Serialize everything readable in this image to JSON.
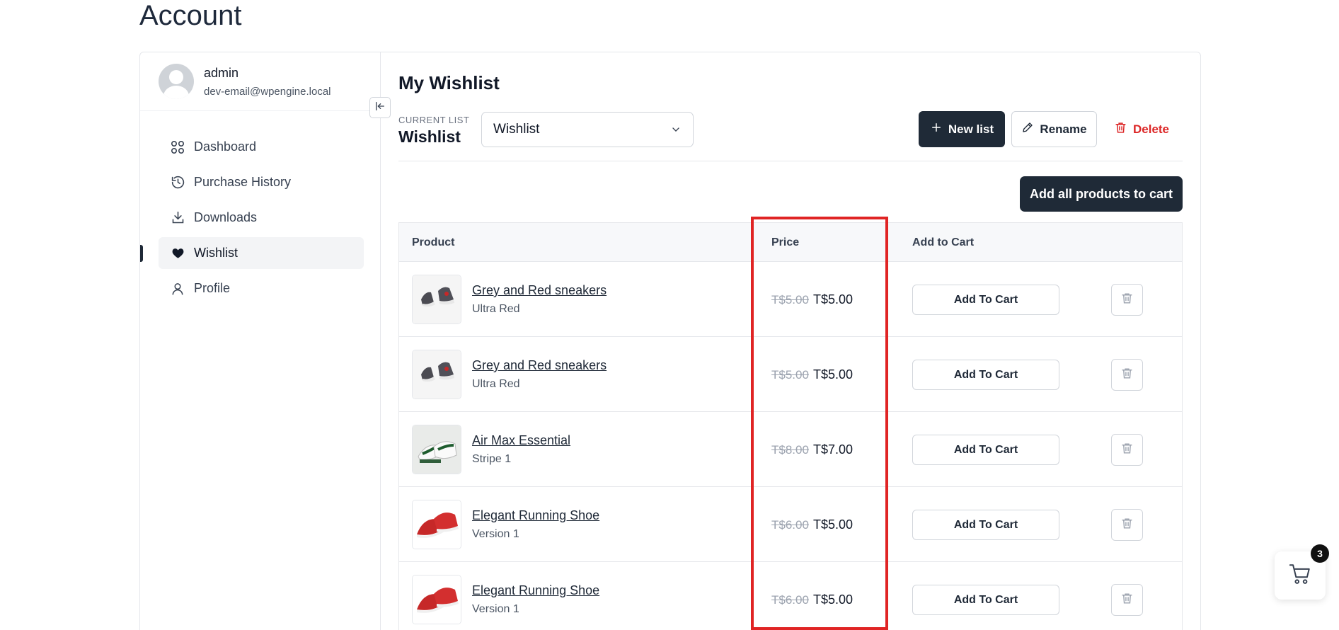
{
  "page": {
    "title": "Account"
  },
  "user": {
    "name": "admin",
    "email": "dev-email@wpengine.local"
  },
  "sidebar": {
    "items": [
      {
        "label": "Dashboard",
        "icon": "grid-icon",
        "active": false
      },
      {
        "label": "Purchase History",
        "icon": "history-icon",
        "active": false
      },
      {
        "label": "Downloads",
        "icon": "download-icon",
        "active": false
      },
      {
        "label": "Wishlist",
        "icon": "heart-icon",
        "active": true
      },
      {
        "label": "Profile",
        "icon": "user-icon",
        "active": false
      }
    ]
  },
  "wishlist": {
    "title": "My Wishlist",
    "current_label": "CURRENT LIST",
    "current_name": "Wishlist",
    "select_value": "Wishlist",
    "new_list_label": "New list",
    "rename_label": "Rename",
    "delete_label": "Delete",
    "add_all_label": "Add all products to cart",
    "columns": {
      "product": "Product",
      "price": "Price",
      "add_to_cart": "Add to Cart"
    },
    "rows": [
      {
        "name": "Grey and Red sneakers",
        "variant": "Ultra Red",
        "old_price": "T$5.00",
        "price": "T$5.00",
        "cart_label": "Add To Cart",
        "thumb": "grey-sneaker"
      },
      {
        "name": "Grey and Red sneakers",
        "variant": "Ultra Red",
        "old_price": "T$5.00",
        "price": "T$5.00",
        "cart_label": "Add To Cart",
        "thumb": "grey-sneaker"
      },
      {
        "name": "Air Max Essential",
        "variant": "Stripe 1",
        "old_price": "T$8.00",
        "price": "T$7.00",
        "cart_label": "Add To Cart",
        "thumb": "white-sneaker"
      },
      {
        "name": "Elegant Running Shoe",
        "variant": "Version 1",
        "old_price": "T$6.00",
        "price": "T$5.00",
        "cart_label": "Add To Cart",
        "thumb": "red-shoe"
      },
      {
        "name": "Elegant Running Shoe",
        "variant": "Version 1",
        "old_price": "T$6.00",
        "price": "T$5.00",
        "cart_label": "Add To Cart",
        "thumb": "red-shoe"
      }
    ]
  },
  "cart": {
    "count": "3"
  },
  "colors": {
    "primary": "#1f2a37",
    "danger": "#dc2626",
    "highlight": "#e02424"
  }
}
